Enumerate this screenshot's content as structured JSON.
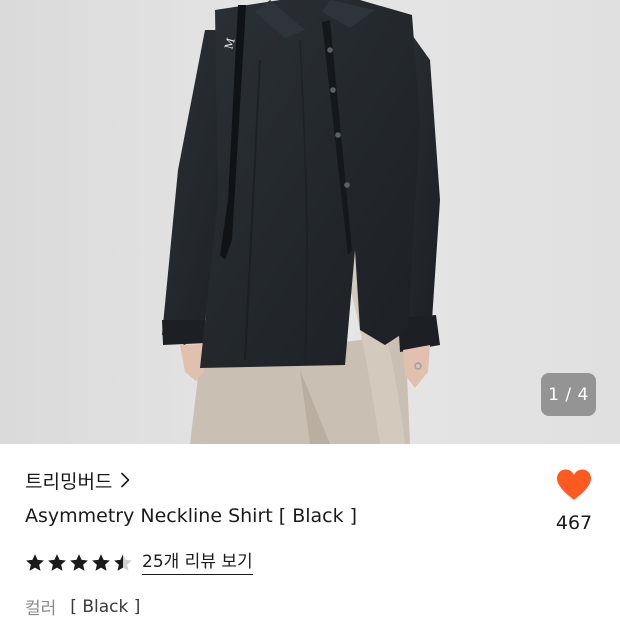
{
  "photo": {
    "page_indicator": "1 / 4",
    "background_color": "#e2e2e2",
    "shirt_color": "#23282c",
    "pants_color": "#c9bfb3"
  },
  "product": {
    "brand": "트리밍버드",
    "title": "Asymmetry Neckline Shirt [ Black ]",
    "rating": 4.5,
    "review_link": "25개 리뷰 보기",
    "color_label": "컬러",
    "color_value": "[ Black ]"
  },
  "like": {
    "count": "467",
    "heart_color": "#ff5a1f"
  },
  "icons": {
    "brand_chevron": "chevron-right-icon",
    "like": "heart-icon",
    "rating": "star-icon"
  }
}
